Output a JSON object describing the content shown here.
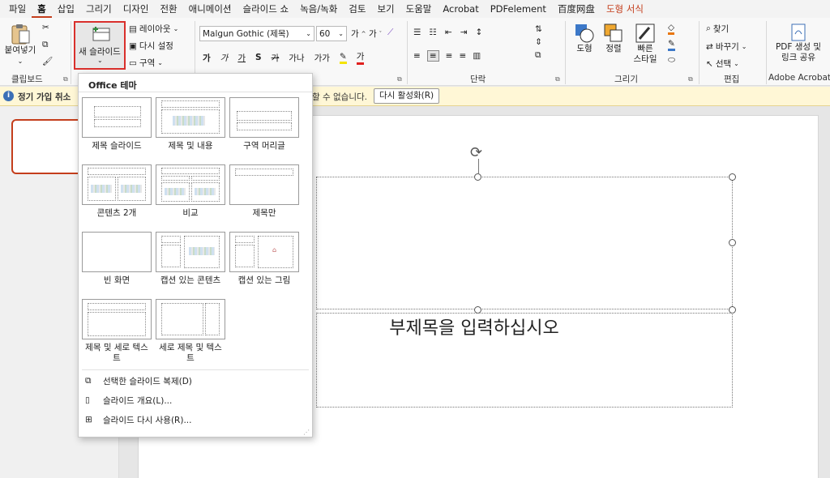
{
  "tabs": [
    "파일",
    "홈",
    "삽입",
    "그리기",
    "디자인",
    "전환",
    "애니메이션",
    "슬라이드 쇼",
    "녹음/녹화",
    "검토",
    "보기",
    "도움말",
    "Acrobat",
    "PDFelement",
    "百度网盘",
    "도형 서식"
  ],
  "active_tab": "홈",
  "ribbon": {
    "paste_label": "붙여넣기",
    "clipboard_group": "클립보드",
    "new_slide_label": "새 슬라이드",
    "layout_label": "레이아웃",
    "reset_label": "다시 설정",
    "section_label": "구역",
    "font_name": "Malgun Gothic (제목)",
    "font_size": "60",
    "paragraph_group": "단락",
    "shape_label": "도형",
    "arrange_label": "정렬",
    "quick_style_label_1": "빠른",
    "quick_style_label_2": "스타일",
    "drawing_group": "그리기",
    "find_label": "찾기",
    "replace_label": "바꾸기",
    "select_label": "선택",
    "edit_group": "편집",
    "pdf_label_1": "PDF 생성 및",
    "pdf_label_2": "링크 공유",
    "acrobat_group": "Adobe Acrobat",
    "font_group_chars": [
      "가",
      "가",
      "가",
      "S",
      "가",
      "가나",
      "가가",
      "가"
    ]
  },
  "infobar": {
    "message_start": "정기 가입 취소",
    "message_end": "할 수 없습니다.",
    "button": "다시 활성화(R)"
  },
  "slide": {
    "subtitle": "부제목을 입력하십시오"
  },
  "dropdown": {
    "title": "Office 테마",
    "layouts": [
      "제목 슬라이드",
      "제목 및 내용",
      "구역 머리글",
      "콘텐츠 2개",
      "비교",
      "제목만",
      "빈 화면",
      "캡션 있는 콘텐츠",
      "캡션 있는 그림",
      "제목 및 세로 텍스트",
      "세로 제목 및 텍스트"
    ],
    "menu_items": [
      "선택한 슬라이드 복제(D)",
      "슬라이드 개요(L)...",
      "슬라이드 다시 사용(R)..."
    ]
  },
  "colors": {
    "accent": "#c43e1c",
    "highlight_border": "#d9302c",
    "infobar_bg": "#fff7d6"
  }
}
